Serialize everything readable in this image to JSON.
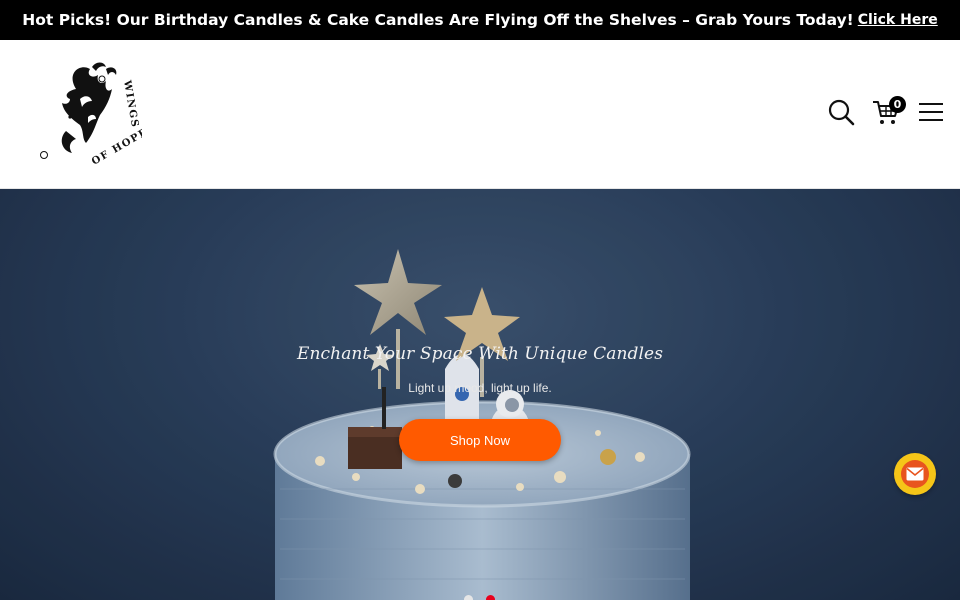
{
  "announcement": {
    "text": "Hot Picks! Our Birthday Candles & Cake Candles Are Flying Off the Shelves – Grab Yours Today!",
    "link_label": "Click Here"
  },
  "header": {
    "logo_text": "WINGS OF HOPE",
    "cart_count": "0",
    "icons": [
      "search-icon",
      "cart-icon",
      "menu-icon"
    ]
  },
  "hero": {
    "title": "Enchant Your Space With Unique Candles",
    "subtitle": "Light up mood, light up life.",
    "button_label": "Shop Now",
    "slides": 2,
    "active_slide": 2
  },
  "colors": {
    "accent": "#ff5a00",
    "active_dot": "#e8001c",
    "announcement_bg": "#000000",
    "mail_button": "#f5c518"
  }
}
